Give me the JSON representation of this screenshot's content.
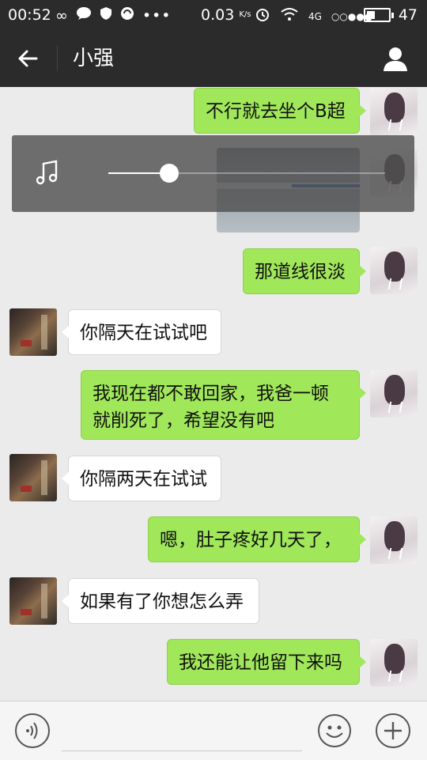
{
  "status_bar": {
    "time": "00:52",
    "speed": "0.03",
    "speed_unit": "K/s",
    "network": "4G",
    "signal_dots": "○○●●●",
    "battery": "47",
    "icons": [
      "infinity-icon",
      "chat-bubble-icon",
      "shield-icon",
      "sync-icon",
      "more-dots-icon",
      "alarm-icon",
      "wifi-icon",
      "battery-icon"
    ]
  },
  "header": {
    "title": "小强",
    "back_icon": "back-arrow-icon",
    "profile_icon": "person-icon"
  },
  "messages": [
    {
      "side": "out",
      "text": "不行就去坐个B超"
    },
    {
      "side": "out",
      "type": "image"
    },
    {
      "side": "out",
      "text": "那道线很淡"
    },
    {
      "side": "in",
      "text": "你隔天在试试吧"
    },
    {
      "side": "out",
      "text": "我现在都不敢回家，我爸一顿就削死了，希望没有吧",
      "lines": [
        "我现在都不敢回家，我爸一顿",
        "就削死了，希望没有吧"
      ]
    },
    {
      "side": "in",
      "text": "你隔两天在试试"
    },
    {
      "side": "out",
      "text": "嗯，肚子疼好几天了，"
    },
    {
      "side": "in",
      "text": "如果有了你想怎么弄"
    },
    {
      "side": "out",
      "text": "我还能让他留下来吗"
    }
  ],
  "player": {
    "icon": "music-note-icon",
    "progress": 0.22
  },
  "input_bar": {
    "voice_icon": "voice-icon",
    "emoji_icon": "emoji-icon",
    "plus_icon": "plus-icon",
    "placeholder": ""
  },
  "colors": {
    "bar": "#2b2b2b",
    "outgoing_bubble": "#a0e75a",
    "incoming_bubble": "#ffffff",
    "background": "#ebebeb"
  }
}
